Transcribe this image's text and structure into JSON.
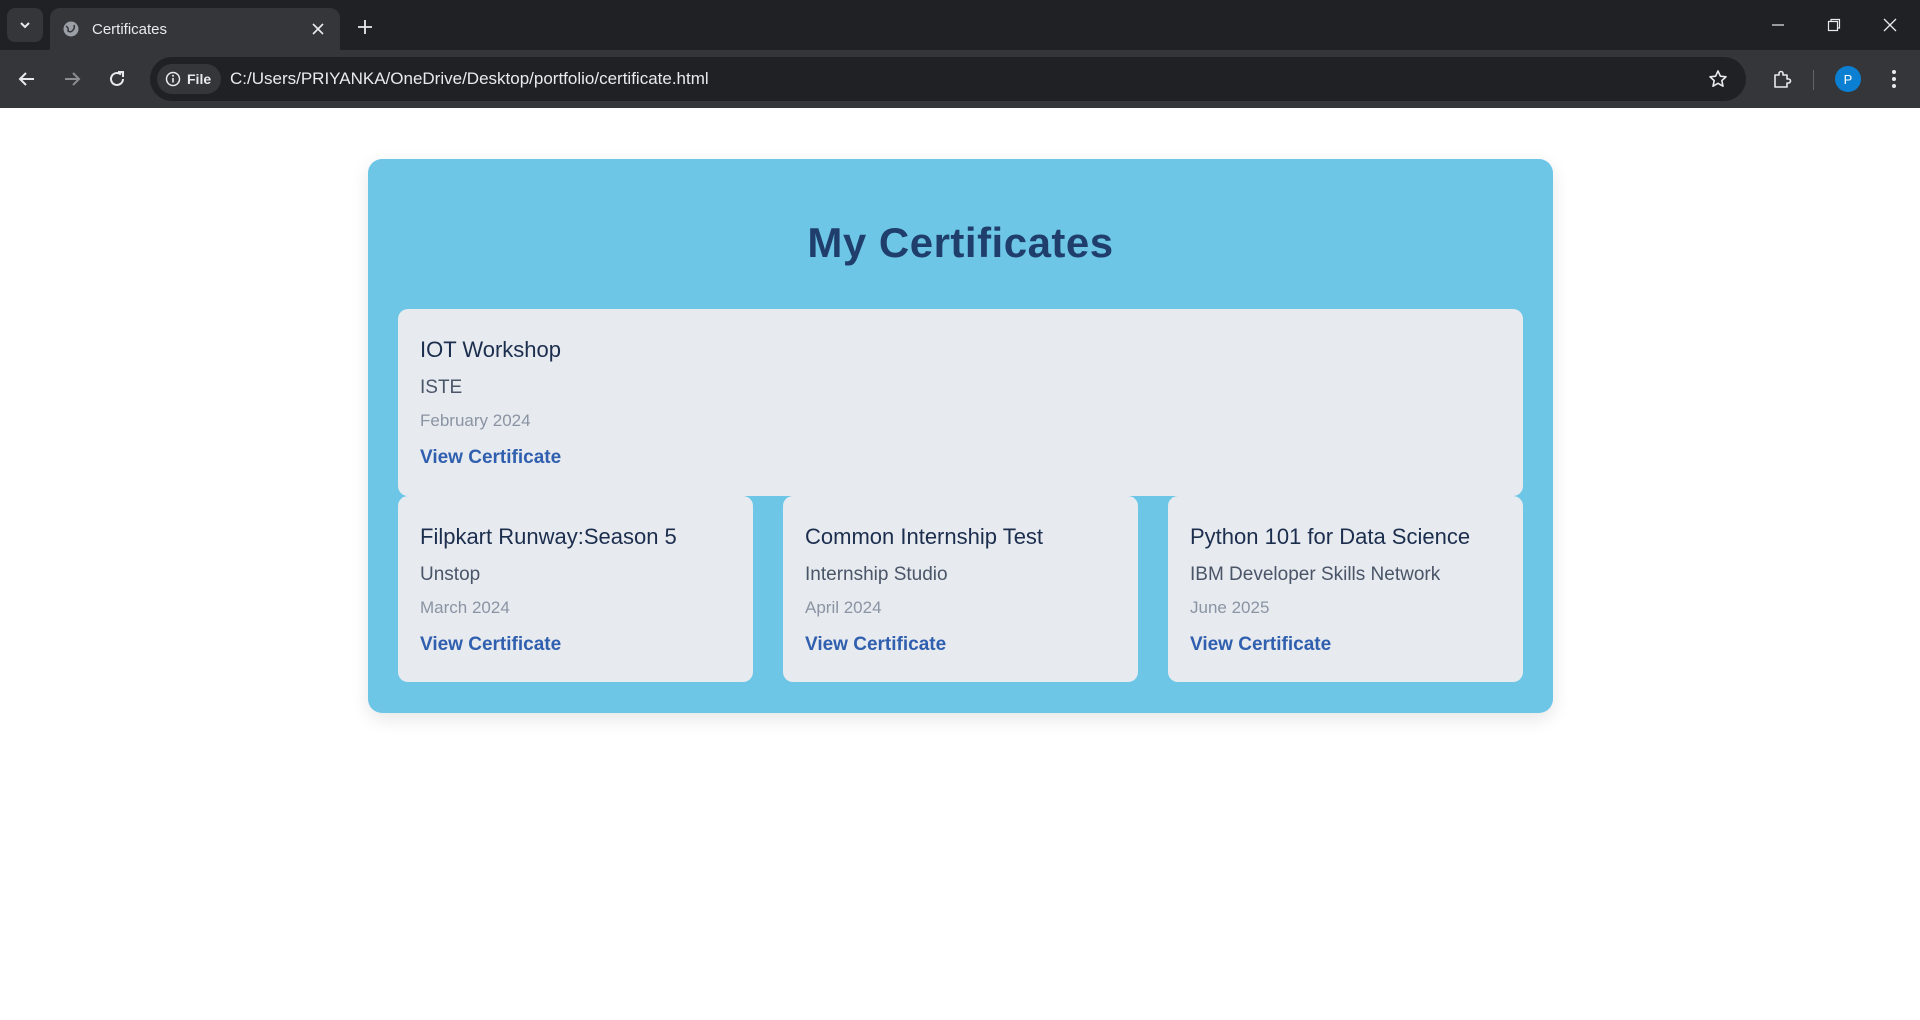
{
  "browser": {
    "tab_title": "Certificates",
    "address_chip": "File",
    "url": "C:/Users/PRIYANKA/OneDrive/Desktop/portfolio/certificate.html",
    "profile_initial": "P"
  },
  "icons": {
    "tab_search": "chevron-down-icon",
    "favicon": "globe-icon",
    "tab_close": "close-icon",
    "new_tab": "plus-icon",
    "back": "arrow-left-icon",
    "forward": "arrow-right-icon",
    "reload": "reload-icon",
    "site_info": "info-icon",
    "bookmark": "star-icon",
    "extensions": "puzzle-icon",
    "menu": "kebab-menu-icon",
    "minimize": "minimize-icon",
    "restore": "restore-icon",
    "close_window": "close-icon"
  },
  "colors": {
    "chrome_dark": "#202124",
    "chrome_mid": "#35363a",
    "container_bg": "#6ec6e6",
    "card_bg": "#e7eaef",
    "title_color": "#1f3e6b",
    "link_color": "#2f5fae",
    "avatar": "#0b7fd1"
  },
  "page": {
    "heading": "My Certificates",
    "certificates": [
      {
        "title": "IOT Workshop",
        "issuer": "ISTE",
        "date": "February 2024",
        "link": "View Certificate"
      },
      {
        "title": "Filpkart Runway:Season 5",
        "issuer": "Unstop",
        "date": "March 2024",
        "link": "View Certificate"
      },
      {
        "title": "Common Internship Test",
        "issuer": "Internship Studio",
        "date": "April 2024",
        "link": "View Certificate"
      },
      {
        "title": "Python 101 for Data Science",
        "issuer": "IBM Developer Skills Network",
        "date": "June 2025",
        "link": "View Certificate"
      }
    ]
  }
}
